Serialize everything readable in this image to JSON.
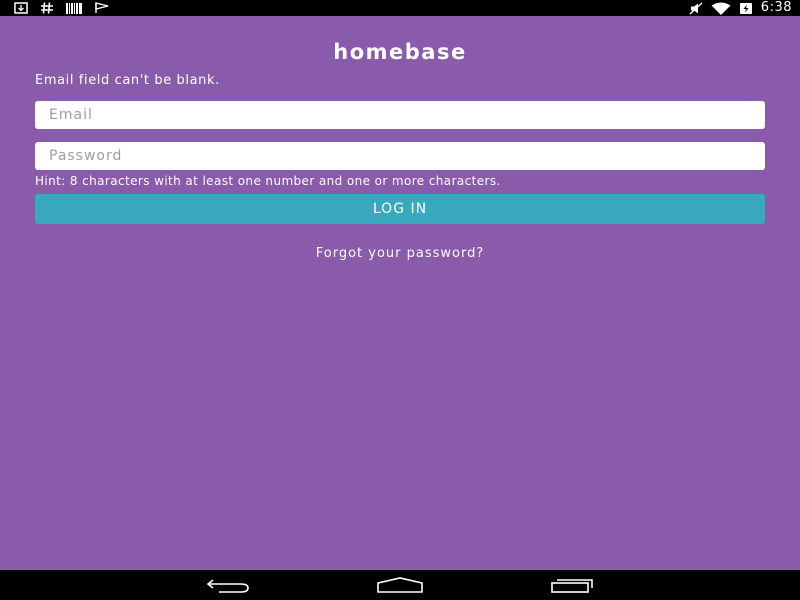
{
  "status_bar": {
    "left_icons": [
      "download-icon",
      "hash-icon",
      "barcode-icon",
      "flag-icon"
    ],
    "right_icons": [
      "mute-icon",
      "wifi-icon",
      "battery-charging-icon"
    ],
    "time": "6:38"
  },
  "app": {
    "title": "homebase",
    "error_message": "Email field can't be blank.",
    "email_placeholder": "Email",
    "password_placeholder": "Password",
    "password_hint": "Hint: 8 characters with at least one number and one or more characters.",
    "login_label": "LOG IN",
    "forgot_label": "Forgot your password?"
  },
  "nav_bar": {
    "buttons": [
      "back-icon",
      "home-icon",
      "recents-icon"
    ]
  },
  "colors": {
    "background": "#8a5aab",
    "button": "#38a9bf",
    "text": "#ffffff"
  }
}
